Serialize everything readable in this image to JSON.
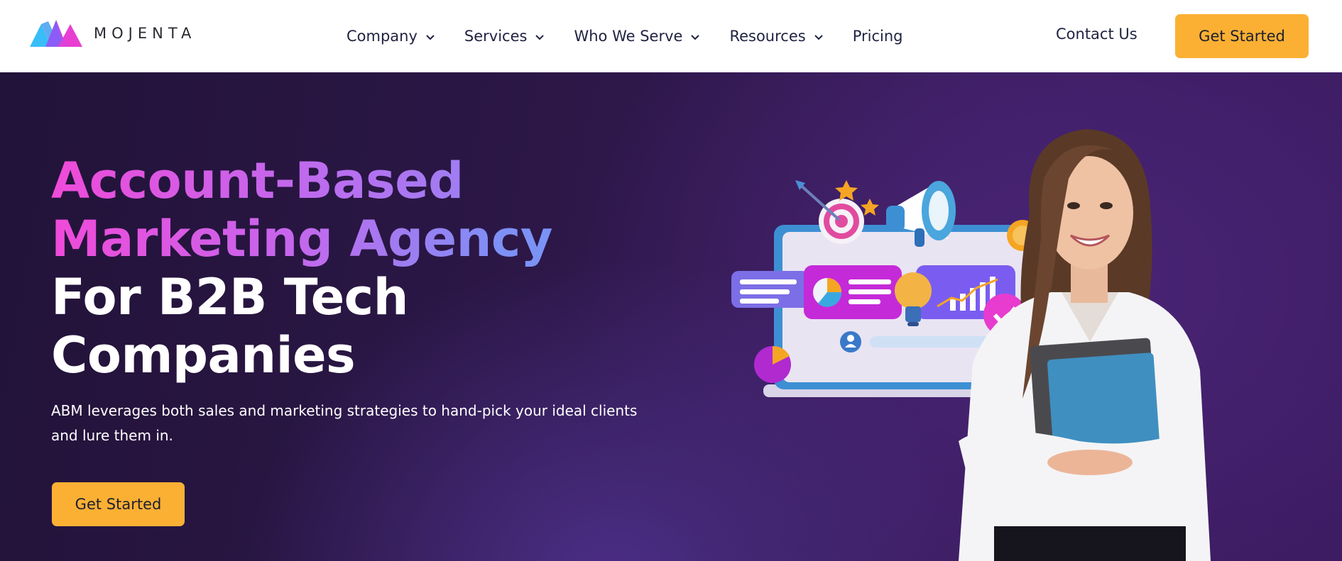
{
  "brand": {
    "name": "MOJENTA",
    "colors": {
      "pink": "#e83fd2",
      "purple": "#8b5cf6",
      "cyan": "#38bdf8"
    }
  },
  "nav": {
    "items": [
      {
        "label": "Company",
        "dropdown": true
      },
      {
        "label": "Services",
        "dropdown": true
      },
      {
        "label": "Who We Serve",
        "dropdown": true
      },
      {
        "label": "Resources",
        "dropdown": true
      },
      {
        "label": "Pricing",
        "dropdown": false
      }
    ],
    "contact_label": "Contact Us",
    "cta_label": "Get Started"
  },
  "hero": {
    "headline_line1": "Account-Based",
    "headline_line2": "Marketing Agency",
    "headline_line3": "For B2B Tech",
    "headline_line4": "Companies",
    "subtext": "ABM leverages both sales and marketing strategies to hand-pick your ideal clients and lure them in.",
    "cta_label": "Get Started"
  },
  "colors": {
    "accent_button": "#fbb034",
    "hero_background": "#2c1747",
    "headline_gradient_start": "#f04ad9",
    "headline_gradient_end": "#6f9bf5"
  },
  "icons": [
    "mojenta-logo-icon",
    "chevron-down-icon",
    "target-icon",
    "megaphone-icon",
    "lightbulb-icon",
    "bar-chart-icon",
    "pie-chart-icon",
    "checkmark-icon",
    "user-icon",
    "coin-icon"
  ]
}
